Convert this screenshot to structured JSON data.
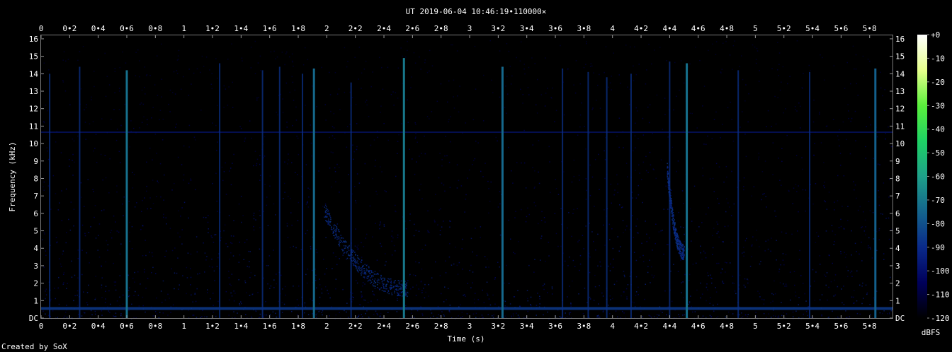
{
  "chart_data": {
    "type": "heatmap",
    "title": "UT 2019-06-04 10:46:19•110000×",
    "xlabel": "Time (s)",
    "ylabel": "Frequency (kHz)",
    "credit": "Created by SoX",
    "xlim": [
      0,
      5.96
    ],
    "ylim": [
      0,
      16.2
    ],
    "x_ticks": [
      "0",
      "0•2",
      "0•4",
      "0•6",
      "0•8",
      "1",
      "1•2",
      "1•4",
      "1•6",
      "1•8",
      "2",
      "2•2",
      "2•4",
      "2•6",
      "2•8",
      "3",
      "3•2",
      "3•4",
      "3•6",
      "3•8",
      "4",
      "4•2",
      "4•4",
      "4•6",
      "4•8",
      "5",
      "5•2",
      "5•4",
      "5•6",
      "5•8"
    ],
    "x_tick_values": [
      0,
      0.2,
      0.4,
      0.6,
      0.8,
      1.0,
      1.2,
      1.4,
      1.6,
      1.8,
      2.0,
      2.2,
      2.4,
      2.6,
      2.8,
      3.0,
      3.2,
      3.4,
      3.6,
      3.8,
      4.0,
      4.2,
      4.4,
      4.6,
      4.8,
      5.0,
      5.2,
      5.4,
      5.6,
      5.8
    ],
    "y_ticks": [
      "DC",
      "1",
      "2",
      "3",
      "4",
      "5",
      "6",
      "7",
      "8",
      "9",
      "10",
      "11",
      "12",
      "13",
      "14",
      "15",
      "16"
    ],
    "y_tick_values": [
      0,
      1,
      2,
      3,
      4,
      5,
      6,
      7,
      8,
      9,
      10,
      11,
      12,
      13,
      14,
      15,
      16
    ],
    "colorbar": {
      "label": "dBFS",
      "ticks": [
        "+0",
        "-10",
        "-20",
        "-30",
        "-40",
        "-50",
        "-60",
        "-70",
        "-80",
        "-90",
        "-100",
        "-110",
        "-120"
      ],
      "tick_values": [
        0,
        -10,
        -20,
        -30,
        -40,
        -50,
        -60,
        -70,
        -80,
        -90,
        -100,
        -110,
        -120
      ],
      "range": [
        -120,
        0
      ],
      "colors": [
        "#000000",
        "#00005a",
        "#0a2a8a",
        "#14648c",
        "#1ea08a",
        "#1ed264",
        "#5af03c",
        "#e6ff8c",
        "#ffffff"
      ]
    },
    "features": {
      "hum_line_khz": 0.55,
      "tone_line_khz": 10.65,
      "background_level_dbfs": -112,
      "strong_impulses": [
        {
          "t": 0.6,
          "top_khz": 14.2,
          "level_dbfs": -72
        },
        {
          "t": 1.91,
          "top_khz": 14.3,
          "level_dbfs": -74
        },
        {
          "t": 2.54,
          "top_khz": 14.9,
          "level_dbfs": -70
        },
        {
          "t": 3.23,
          "top_khz": 14.4,
          "level_dbfs": -74
        },
        {
          "t": 4.52,
          "top_khz": 14.6,
          "level_dbfs": -72
        },
        {
          "t": 5.84,
          "top_khz": 14.3,
          "level_dbfs": -76
        }
      ],
      "medium_impulses": [
        {
          "t": 0.06,
          "top_khz": 14.0
        },
        {
          "t": 0.27,
          "top_khz": 14.4
        },
        {
          "t": 1.25,
          "top_khz": 14.6
        },
        {
          "t": 1.55,
          "top_khz": 14.2
        },
        {
          "t": 1.67,
          "top_khz": 14.4
        },
        {
          "t": 1.83,
          "top_khz": 14.0
        },
        {
          "t": 2.17,
          "top_khz": 13.5
        },
        {
          "t": 3.65,
          "top_khz": 14.3
        },
        {
          "t": 3.83,
          "top_khz": 14.1
        },
        {
          "t": 3.96,
          "top_khz": 13.8
        },
        {
          "t": 4.13,
          "top_khz": 14.0
        },
        {
          "t": 4.4,
          "top_khz": 14.7
        },
        {
          "t": 4.88,
          "top_khz": 14.2
        },
        {
          "t": 5.38,
          "top_khz": 14.1
        }
      ],
      "whistler_sweeps": [
        {
          "t_start": 1.98,
          "t_end": 2.56,
          "f_start_khz": 6.2,
          "f_end_khz": 1.7
        },
        {
          "t_start": 4.38,
          "t_end": 4.5,
          "f_start_khz": 8.5,
          "f_end_khz": 3.8
        }
      ]
    }
  }
}
